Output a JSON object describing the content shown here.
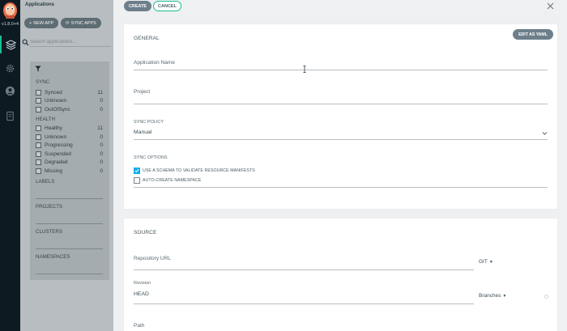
{
  "nav": {
    "version": "v1.8.0+4",
    "items": [
      "applications-icon",
      "settings-icon",
      "user-icon",
      "docs-icon"
    ]
  },
  "apps": {
    "title": "Applications",
    "new_app_label": "NEW APP",
    "sync_apps_label": "SYNC APPS",
    "search_placeholder": "Search applications...",
    "filters": {
      "sync_title": "SYNC",
      "sync": [
        {
          "label": "Synced",
          "count": "11"
        },
        {
          "label": "Unknown",
          "count": "0"
        },
        {
          "label": "OutOfSync",
          "count": "0"
        }
      ],
      "health_title": "HEALTH",
      "health": [
        {
          "label": "Healthy",
          "count": "11"
        },
        {
          "label": "Unknown",
          "count": "0"
        },
        {
          "label": "Progressing",
          "count": "0"
        },
        {
          "label": "Suspended",
          "count": "0"
        },
        {
          "label": "Degraded",
          "count": "0"
        },
        {
          "label": "Missing",
          "count": "0"
        }
      ],
      "labels_title": "LABELS",
      "projects_title": "PROJECTS",
      "clusters_title": "CLUSTERS",
      "namespaces_title": "NAMESPACES"
    }
  },
  "form": {
    "create_label": "CREATE",
    "cancel_label": "CANCEL",
    "general": {
      "title": "GENERAL",
      "edit_yaml_label": "EDIT AS YAML",
      "app_name_label": "Application Name",
      "project_label": "Project",
      "sync_policy_label": "SYNC POLICY",
      "sync_policy_value": "Manual",
      "sync_options_label": "SYNC OPTIONS",
      "option_schema": "USE A SCHEMA TO VALIDATE RESOURCE MANIFESTS",
      "option_namespace": "AUTO-CREATE NAMESPACE"
    },
    "source": {
      "title": "SOURCE",
      "repo_url_label": "Repository URL",
      "repo_type": "GIT",
      "revision_label": "Revision",
      "revision_value": "HEAD",
      "revision_type": "Branches",
      "path_label": "Path"
    }
  },
  "colors": {
    "accent": "#18be94",
    "checkbox": "#0dadea",
    "nav": "#0e1a22"
  }
}
